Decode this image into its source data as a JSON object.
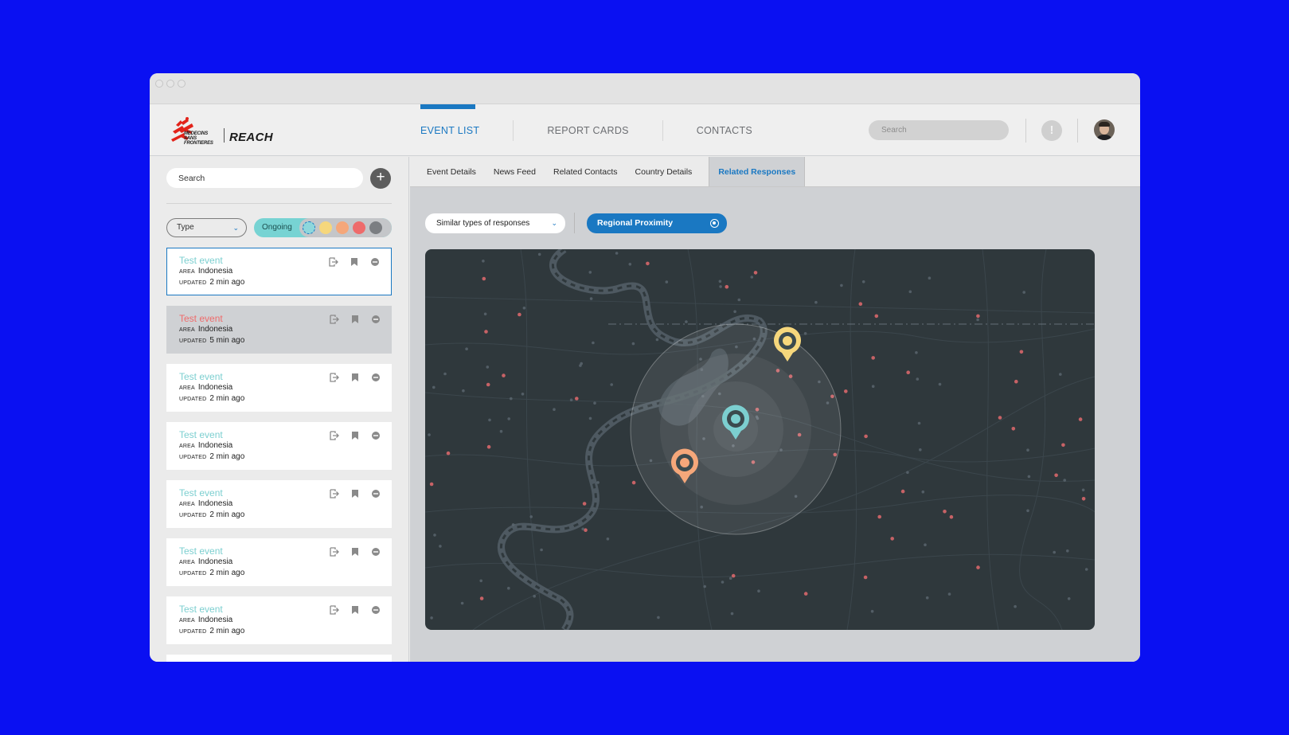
{
  "app": {
    "logo_text": "REACH",
    "logo_subtext": "MEDECINS SANS FRONTIERES"
  },
  "nav": {
    "items": [
      {
        "label": "EVENT LIST",
        "active": true
      },
      {
        "label": "REPORT CARDS",
        "active": false
      },
      {
        "label": "CONTACTS",
        "active": false
      }
    ],
    "search_placeholder": "Search",
    "alert_icon": "!"
  },
  "sidebar": {
    "search_placeholder": "Search",
    "add_icon": "+",
    "type_filter": "Type",
    "status_filter": "Ongoing",
    "severity_colors": [
      "#8ed7dc",
      "#f6d77c",
      "#f5a77a",
      "#ee6b6b",
      "#7b7e82"
    ],
    "events": [
      {
        "title": "Test event",
        "area_key": "AREA",
        "area": "Indonesia",
        "updated_key": "UPDATED",
        "updated": "2 min ago",
        "color": "#7ccfd0"
      },
      {
        "title": "Test event",
        "area_key": "AREA",
        "area": "Indonesia",
        "updated_key": "UPDATED",
        "updated": "5 min ago",
        "color": "#ef6b6b"
      },
      {
        "title": "Test event",
        "area_key": "AREA",
        "area": "Indonesia",
        "updated_key": "UPDATED",
        "updated": "2 min ago",
        "color": "#7ccfd0"
      },
      {
        "title": "Test event",
        "area_key": "AREA",
        "area": "Indonesia",
        "updated_key": "UPDATED",
        "updated": "2 min ago",
        "color": "#7ccfd0"
      },
      {
        "title": "Test event",
        "area_key": "AREA",
        "area": "Indonesia",
        "updated_key": "UPDATED",
        "updated": "2 min ago",
        "color": "#7ccfd0"
      },
      {
        "title": "Test event",
        "area_key": "AREA",
        "area": "Indonesia",
        "updated_key": "UPDATED",
        "updated": "2 min ago",
        "color": "#7ccfd0"
      },
      {
        "title": "Test event",
        "area_key": "AREA",
        "area": "Indonesia",
        "updated_key": "UPDATED",
        "updated": "2 min ago",
        "color": "#7ccfd0"
      }
    ]
  },
  "main": {
    "tabs": [
      {
        "label": "Event Details",
        "active": false
      },
      {
        "label": "News Feed",
        "active": false
      },
      {
        "label": "Related Contacts",
        "active": false
      },
      {
        "label": "Country Details",
        "active": false
      },
      {
        "label": "Related Responses",
        "active": true
      }
    ],
    "similar_select": "Similar types of responses",
    "proximity_toggle": "Regional Proximity",
    "map": {
      "markers": [
        {
          "name": "center-marker",
          "color": "#7ccfd0"
        },
        {
          "name": "yellow-marker",
          "color": "#f6d77c"
        },
        {
          "name": "orange-marker",
          "color": "#f5a77a"
        }
      ]
    }
  },
  "colors": {
    "accent": "#1a78c2",
    "background": "#0a10f2",
    "map_bg": "#2f383c"
  }
}
